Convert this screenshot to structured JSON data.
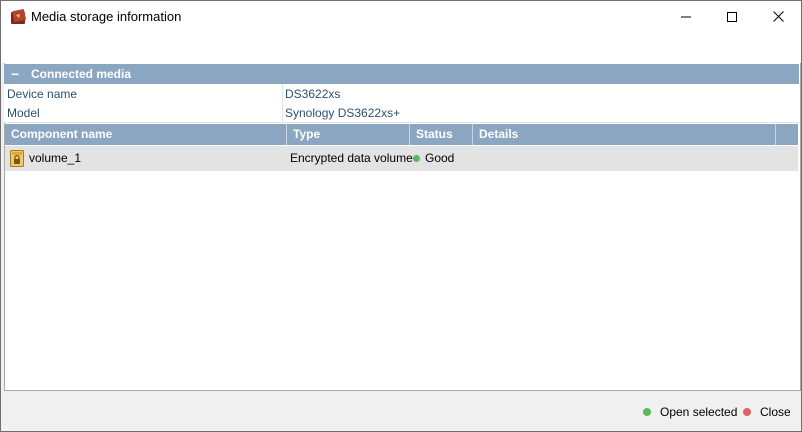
{
  "window": {
    "title": "Media storage information",
    "app_icon": "app-icon",
    "controls": {
      "minimize_icon": "minimize-icon",
      "maximize_icon": "maximize-icon",
      "close_icon": "close-icon"
    }
  },
  "group": {
    "collapse_symbol": "−",
    "title": "Connected media"
  },
  "info": [
    {
      "label": "Device name",
      "value": "DS3622xs"
    },
    {
      "label": "Model",
      "value": "Synology DS3622xs+"
    }
  ],
  "table": {
    "columns": [
      "Component name",
      "Type",
      "Status",
      "Details"
    ],
    "rows": [
      {
        "icon": "encrypted-volume-icon",
        "name": "volume_1",
        "type": "Encrypted data volume",
        "status": "Good",
        "details": ""
      }
    ]
  },
  "footer": {
    "open_label": "Open selected",
    "close_label": "Close"
  },
  "colors": {
    "header_bg": "#8aa6c1",
    "status_good": "#5cb85c",
    "open_dot": "#5cb85c",
    "close_dot": "#e06262",
    "selected_row_bg": "#e3e3e3"
  }
}
